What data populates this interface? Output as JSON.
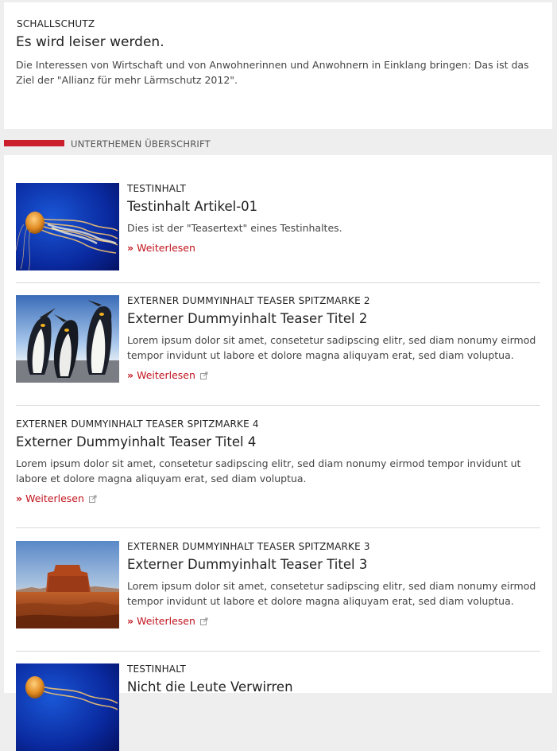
{
  "intro": {
    "kicker": "SCHALLSCHUTZ",
    "title": "Es wird leiser werden.",
    "description": "Die Interessen von Wirtschaft und von Anwohnerinnen und Anwohnern in Einklang bringen: Das ist das Ziel der \"Allianz für mehr Lärmschutz 2012\"."
  },
  "section": {
    "label": "UNTERTHEMEN ÜBERSCHRIFT",
    "accent_color": "#cc1f2d"
  },
  "items": [
    {
      "kicker": "TESTINHALT",
      "title": "Testinhalt Artikel-01",
      "description": "Dies ist der \"Teasertext\" eines Testinhaltes.",
      "link": "Weiterlesen",
      "image": "jellyfish-image",
      "external": false
    },
    {
      "kicker": "EXTERNER DUMMYINHALT TEASER SPITZMARKE 2",
      "title": "Externer Dummyinhalt Teaser Titel 2",
      "description": "Lorem ipsum dolor sit amet, consetetur sadipscing elitr, sed diam nonumy eirmod tempor invidunt ut labore et dolore magna aliquyam erat, sed diam voluptua.",
      "link": "Weiterlesen",
      "image": "penguins-image",
      "external": true
    },
    {
      "kicker": "EXTERNER DUMMYINHALT TEASER SPITZMARKE 4",
      "title": "Externer Dummyinhalt Teaser Titel 4",
      "description": "Lorem ipsum dolor sit amet, consetetur sadipscing elitr, sed diam nonumy eirmod tempor invidunt ut labore et dolore magna aliquyam erat, sed diam voluptua.",
      "link": "Weiterlesen",
      "image": "",
      "external": true
    },
    {
      "kicker": "EXTERNER DUMMYINHALT TEASER SPITZMARKE 3",
      "title": "Externer Dummyinhalt Teaser Titel 3",
      "description": "Lorem ipsum dolor sit amet, consetetur sadipscing elitr, sed diam nonumy eirmod tempor invidunt ut labore et dolore magna aliquyam erat, sed diam voluptua.",
      "link": "Weiterlesen",
      "image": "desert-image",
      "external": true
    },
    {
      "kicker": "TESTINHALT",
      "title": "Nicht die Leute Verwirren",
      "image": "jellyfish-image"
    }
  ],
  "colors": {
    "link": "#c0141e",
    "page_bg": "#eeeeee"
  }
}
